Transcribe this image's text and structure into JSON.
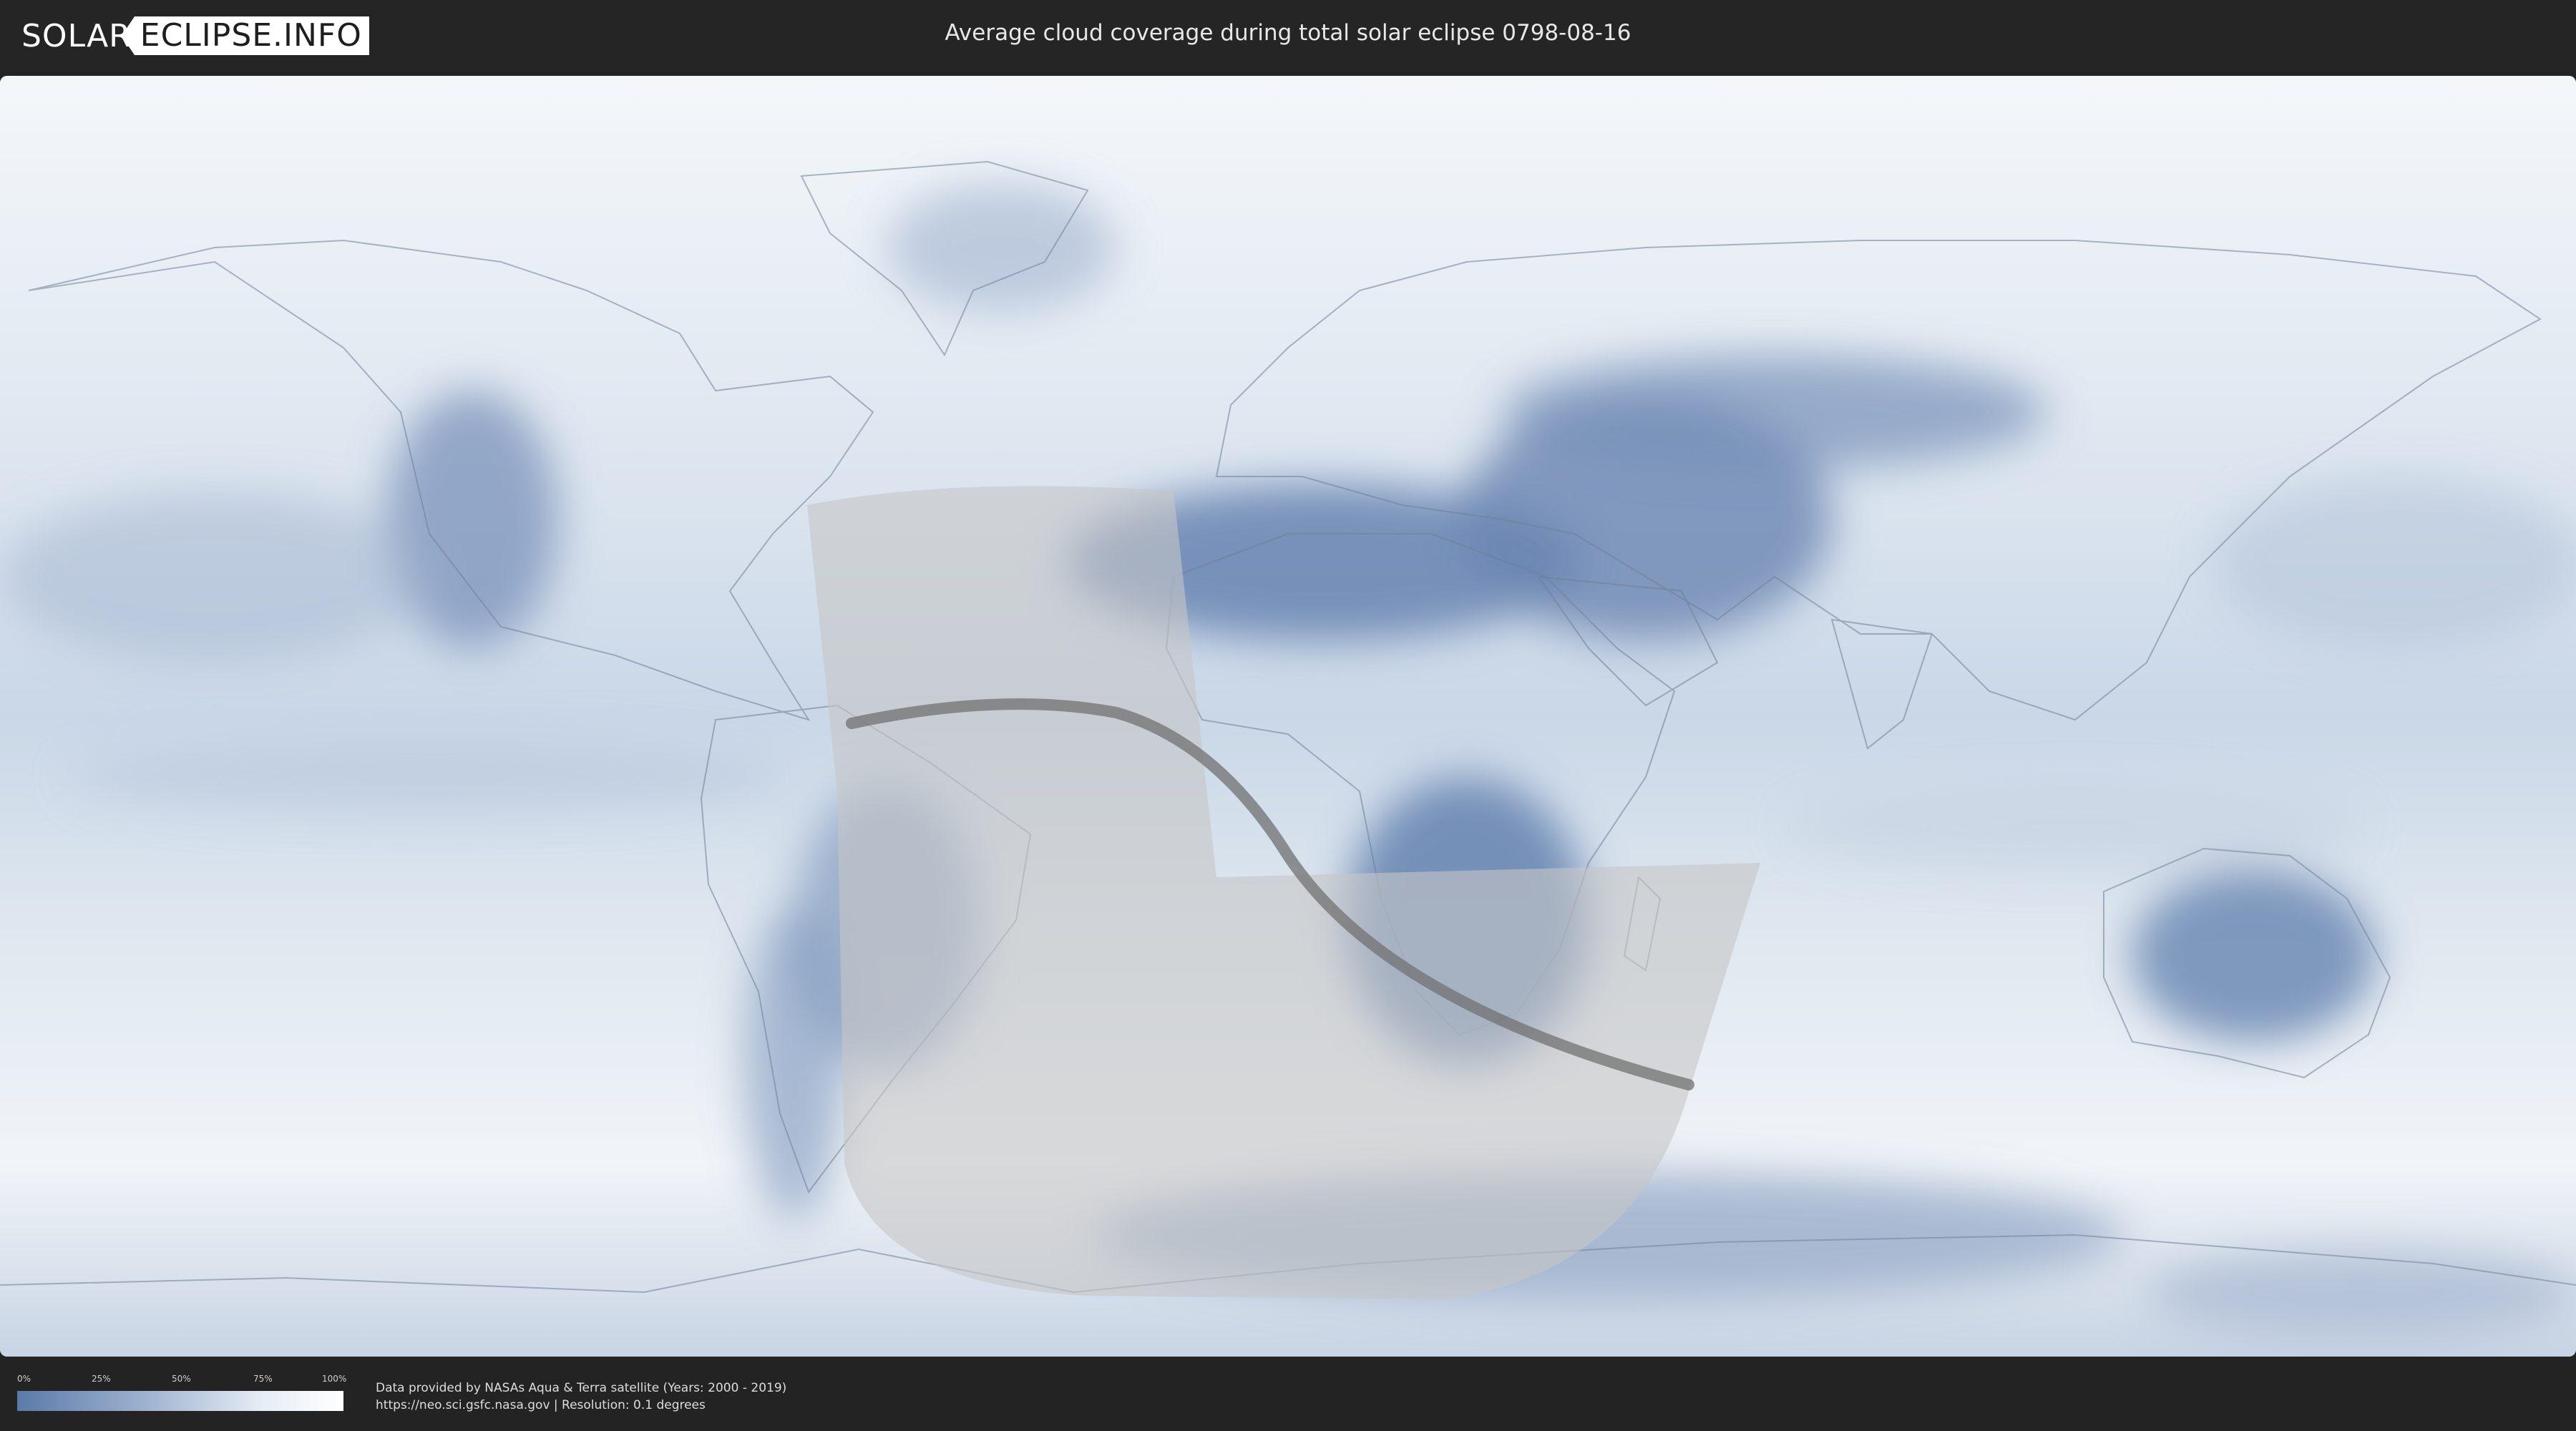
{
  "header": {
    "logo_left": "SOLAR",
    "logo_right": "ECLIPSE.INFO",
    "title": "Average cloud coverage during total solar eclipse 0798-08-16"
  },
  "legend": {
    "ticks": [
      "0%",
      "25%",
      "50%",
      "75%",
      "100%"
    ],
    "gradient_colors": [
      "#5b7aa8",
      "#9fb3d0",
      "#e6edf5",
      "#ffffff"
    ]
  },
  "credits": {
    "line1": "Data provided by NASAs Aqua & Terra satellite (Years: 2000 - 2019)",
    "line2": "https://neo.sci.gsfc.nasa.gov | Resolution: 0.1 degrees"
  },
  "map": {
    "projection": "equirectangular world map",
    "background_cloud_color": "#eef2f7",
    "low_cloud_color": "#5d7dab",
    "eclipse_visibility_zone_color": "#c8c8c8",
    "totality_path_color": "#6e6e6e"
  }
}
